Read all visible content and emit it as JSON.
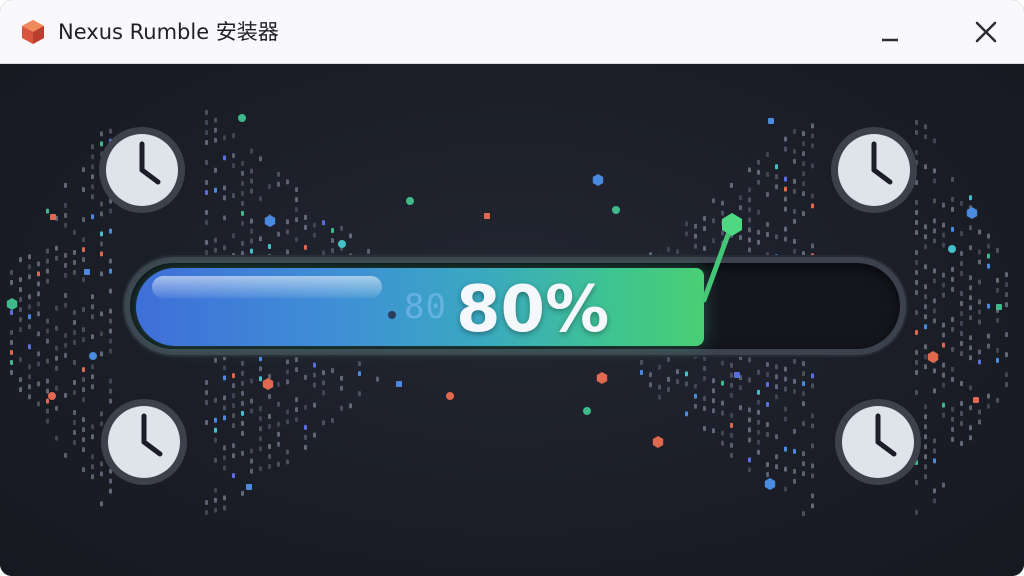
{
  "window": {
    "title": "Nexus Rumble 安装器",
    "app_icon": "orange-cube-icon",
    "minimize_icon": "minimize-icon",
    "close_icon": "close-icon"
  },
  "progress": {
    "percent_label": "80%",
    "value": 0.8,
    "ghost_label": "80"
  },
  "colors": {
    "fill_start": "#3f6fd9",
    "fill_end": "#49cf74",
    "background": "#1b1e27",
    "accent": "#e0694f"
  },
  "decorations": {
    "clock_icon": "clock-icon",
    "particle_icon": "confetti-particle"
  }
}
